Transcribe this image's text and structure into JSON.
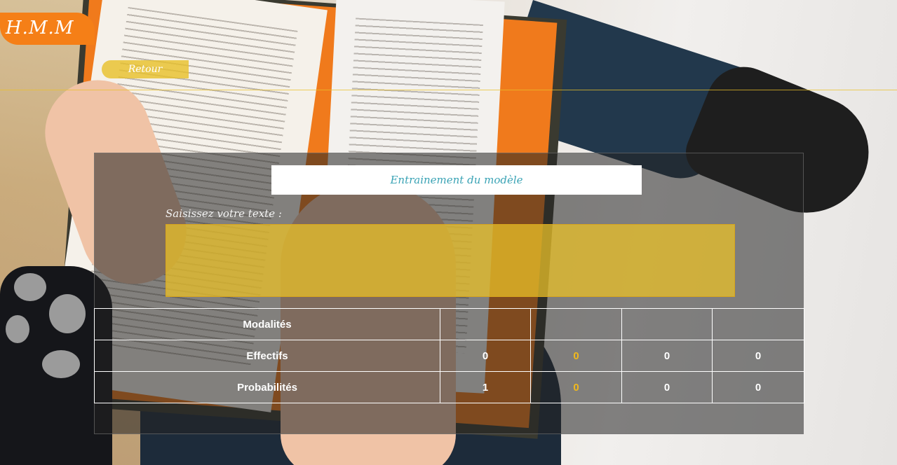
{
  "header": {
    "logo_text": "H.M.M",
    "back_label": "Retour"
  },
  "panel": {
    "title": "Entrainement du modèle",
    "input_label": "Saisissez votre texte :",
    "input_value": "",
    "input_placeholder": ""
  },
  "table": {
    "rows": [
      {
        "label": "Modalités",
        "cells": [
          "",
          "",
          "",
          ""
        ]
      },
      {
        "label": "Effectifs",
        "cells": [
          "0",
          "0",
          "0",
          "0"
        ]
      },
      {
        "label": "Probabilités",
        "cells": [
          "1",
          "0",
          "0",
          "0"
        ]
      }
    ],
    "accent_column": 2
  },
  "colors": {
    "logo": "#f57f17",
    "accent_yellow": "#e9c028",
    "title_text": "#3aa3b5",
    "accent_value": "#f0b81c"
  }
}
